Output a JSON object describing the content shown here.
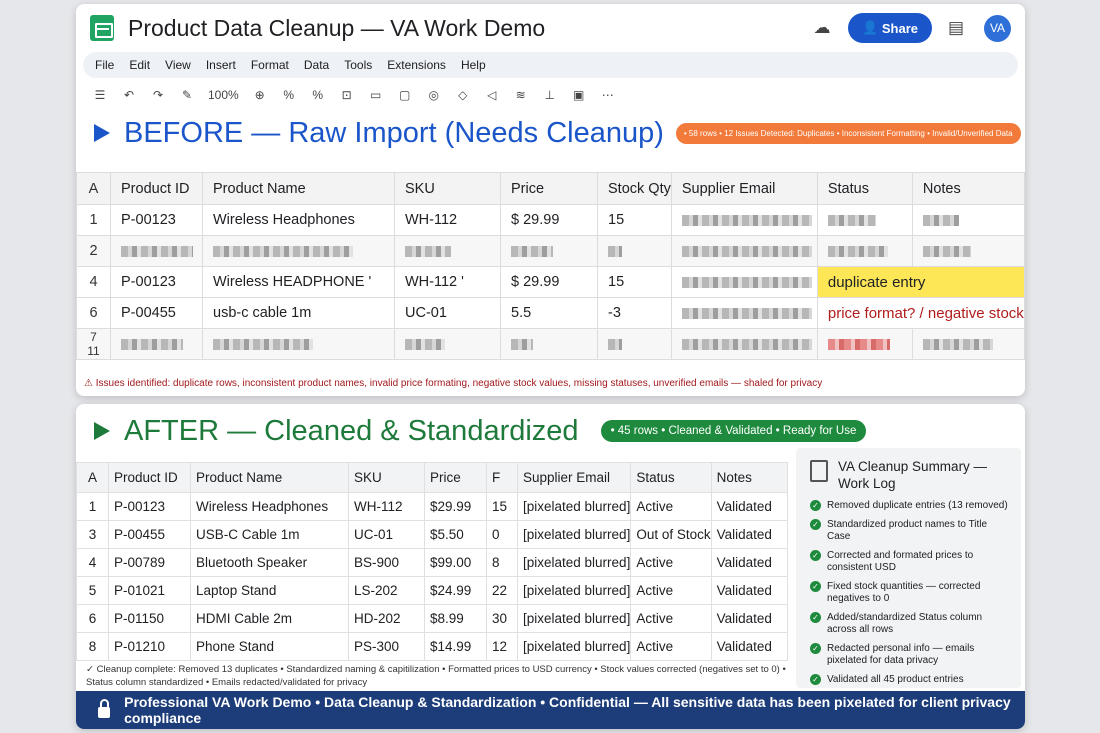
{
  "header": {
    "title": "Product Data Cleanup — VA Work Demo",
    "share": "Share",
    "avatar": "VA"
  },
  "menu": [
    "File",
    "Edit",
    "View",
    "Insert",
    "Format",
    "Data",
    "Tools",
    "Extensions",
    "Help"
  ],
  "toolbar": {
    "zoom": "100%",
    "percent": "%"
  },
  "before": {
    "title": "BEFORE — Raw Import (Needs Cleanup)",
    "badge": "• 58 rows • 12 Issues Detected: Duplicates • Inconsistent Formatting • Invalid/Unverified Data",
    "headers": [
      "A",
      "Product ID",
      "Product Name",
      "SKU",
      "Price",
      "Stock Qty",
      "Supplier Email",
      "Status",
      "Notes"
    ],
    "rows": [
      {
        "n": "1",
        "id": "P-00123",
        "name": "Wireless Headphones",
        "sku": "WH-112",
        "price": "$ 29.99",
        "qty": "15"
      },
      {
        "n": "2"
      },
      {
        "n": "4",
        "id": "P-00123",
        "name": "Wireless HEADPHONE '",
        "sku": "WH-112 '",
        "price": "$ 29.99",
        "qty": "15",
        "status": "duplicate entry"
      },
      {
        "n": "6",
        "id": "P-00455",
        "name": "usb-c cable 1m",
        "sku": "UC-01",
        "price": "5.5",
        "qty": "-3",
        "status": "price format? / negative stock"
      },
      {
        "n": "7"
      },
      {
        "n": "11"
      }
    ],
    "warning": "Issues identified: duplicate rows, inconsistent product names, invalid price formating, negative stock values, missing statuses, unverified emails — shaled for privacy"
  },
  "after": {
    "title": "AFTER — Cleaned & Standardized",
    "badge": "• 45 rows • Cleaned & Validated • Ready for Use",
    "headers": [
      "A",
      "Product ID",
      "Product Name",
      "SKU",
      "Price",
      "F",
      "Supplier Email",
      "Status",
      "Notes"
    ],
    "rows": [
      [
        "1",
        "P-00123",
        "Wireless Headphones",
        "WH-112",
        "$29.99",
        "15",
        "[pixelated blurred]",
        "Active",
        "Validated"
      ],
      [
        "3",
        "P-00455",
        "USB-C Cable 1m",
        "UC-01",
        "$5.50",
        "0",
        "[pixelated blurred]",
        "Out of Stock",
        "Validated"
      ],
      [
        "4",
        "P-00789",
        "Bluetooth Speaker",
        "BS-900",
        "$99.00",
        "8",
        "[pixelated blurred]",
        "Active",
        "Validated"
      ],
      [
        "5",
        "P-01021",
        "Laptop Stand",
        "LS-202",
        "$24.99",
        "22",
        "[pixelated blurred]",
        "Active",
        "Validated"
      ],
      [
        "6",
        "P-01150",
        "HDMI Cable 2m",
        "HD-202",
        "$8.99",
        "30",
        "[pixelated blurred]",
        "Active",
        "Validated"
      ],
      [
        "8",
        "P-01210",
        "Phone Stand",
        "PS-300",
        "$14.99",
        "12",
        "[pixelated blurred]",
        "Active",
        "Validated"
      ]
    ],
    "footer": "✓ Cleanup complete: Removed 13 duplicates • Standardized naming & capitilization • Formatted prices to USD currency • Stock values corrected (negatives set to 0) • Status column standardized • Emails redacted/validated for privacy"
  },
  "summary": {
    "title": "VA Cleanup Summary — Work Log",
    "items": [
      "Removed duplicate entries (13 removed)",
      "Standardized product names to Title Case",
      "Corrected and formated prices to consistent USD",
      "Fixed stock quantities — corrected negatives to 0",
      "Added/standardized Status column across all rows",
      "Redacted personal info — emails pixelated for data privacy",
      "Validated all 45 product entries"
    ]
  },
  "banner": "Professional VA Work Demo • Data Cleanup & Standardization • Confidential — All sensitive data has been pixelated for client privacy compliance"
}
